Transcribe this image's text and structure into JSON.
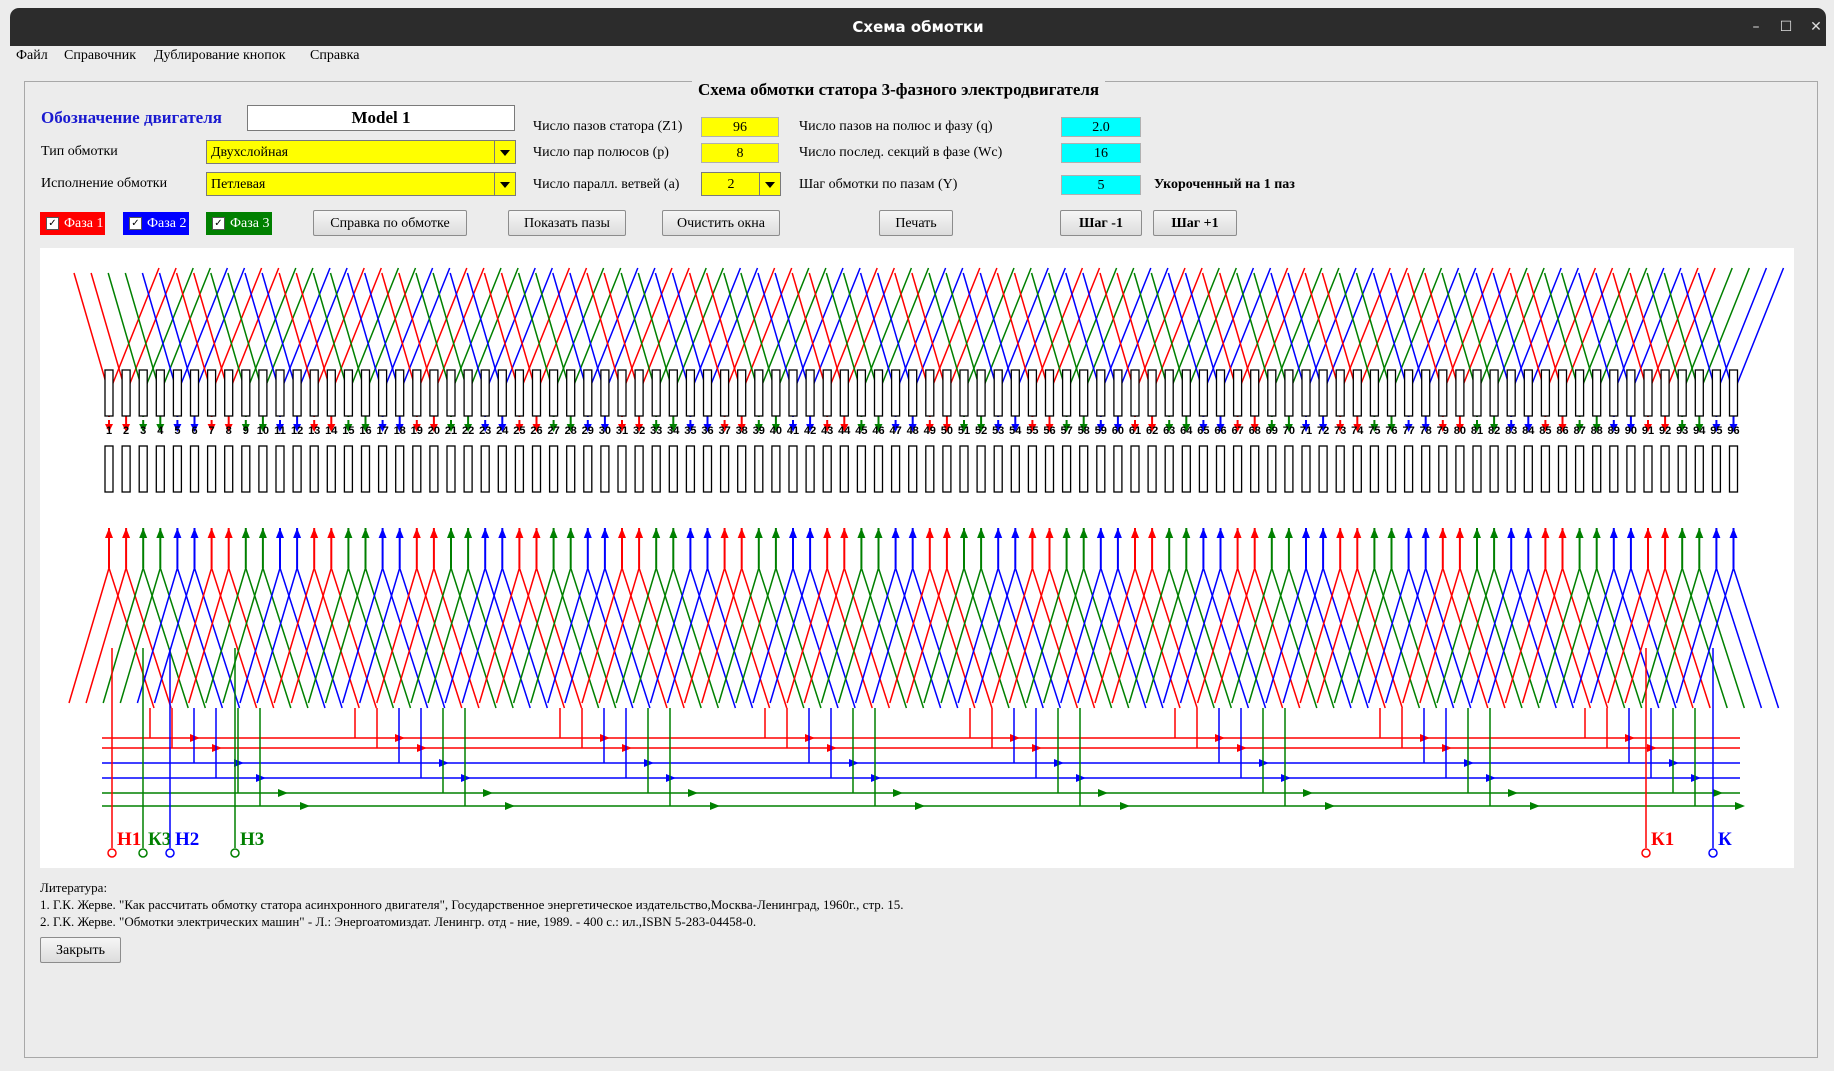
{
  "window": {
    "title": "Схема обмотки"
  },
  "menu": [
    "Файл",
    "Справочник",
    "Дублирование кнопок",
    "Справка"
  ],
  "panel": {
    "title": "Схема обмотки статора 3-фазного электродвигателя"
  },
  "engine": {
    "label": "Обозначение двигателя",
    "value": "Model 1"
  },
  "winding_type": {
    "label": "Тип обмотки",
    "value": "Двухслойная"
  },
  "winding_exec": {
    "label": "Исполнение обмотки",
    "value": "Петлевая"
  },
  "params": {
    "z1_label": "Число пазов статора (Z1)",
    "z1": "96",
    "p_label": "Число пар полюсов (p)",
    "p": "8",
    "a_label": "Число паралл. ветвей (a)",
    "a": "2",
    "q_label": "Число пазов на полюс и фазу (q)",
    "q": "2.0",
    "wc_label": "Число послед. секций в фазе (Wc)",
    "wc": "16",
    "y_label": "Шаг обмотки по пазам (Y)",
    "y": "5",
    "shortening": "Укороченный на 1 паз"
  },
  "phases": [
    {
      "label": "Фаза 1",
      "color": "#ff0000",
      "checked": true
    },
    {
      "label": "Фаза 2",
      "color": "#0000ff",
      "checked": true
    },
    {
      "label": "Фаза 3",
      "color": "#008000",
      "checked": true
    }
  ],
  "buttons": {
    "help": "Справка по обмотке",
    "show_slots": "Показать пазы",
    "clear": "Очистить окна",
    "print": "Печать",
    "step_minus": "Шаг -1",
    "step_plus": "Шаг +1",
    "close": "Закрыть"
  },
  "terminals": {
    "h1": "Н1",
    "k3": "К3",
    "h2": "Н2",
    "h3": "Н3",
    "k1": "К1",
    "k2": "К"
  },
  "literature": {
    "title": "Литература:",
    "item1": "1. Г.К. Жерве. \"Как рассчитать обмотку статора асинхронного двигателя\", Государственное энергетическое издательство,Москва-Ленинград, 1960г., стр. 15.",
    "item2": "2. Г.К. Жерве. \"Обмотки электрических машин\" - Л.: Энергоатомиздат. Ленингр. отд - ние, 1989. - 400 с.: ил.,ISBN 5-283-04458-0."
  }
}
